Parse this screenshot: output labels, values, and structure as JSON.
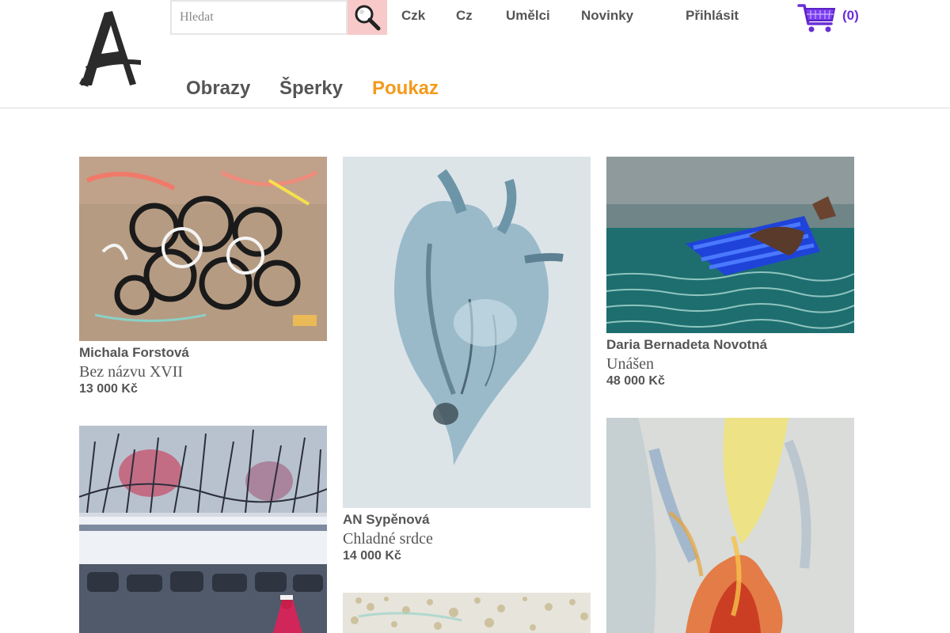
{
  "brand": {
    "logo_letter": "A"
  },
  "search": {
    "placeholder": "Hledat"
  },
  "top_nav": {
    "currency": "Czk",
    "language": "Cz",
    "artists": "Umělci",
    "news": "Novinky",
    "login": "Přihlásit"
  },
  "cart": {
    "count_label": "(0)"
  },
  "main_nav": {
    "paintings": "Obrazy",
    "jewelry": "Šperky",
    "voucher": "Poukaz"
  },
  "colors": {
    "accent": "#f39a1b",
    "cart": "#6a2fd6",
    "search_button": "#f8c9c9",
    "text": "#555555"
  },
  "products": [
    {
      "artist": "Michala Forstová",
      "title": "Bez názvu XVII",
      "price": "13 000 Kč"
    },
    {
      "artist": "AN Sypěnová",
      "title": "Chladné srdce",
      "price": "14 000 Kč"
    },
    {
      "artist": "Daria Bernadeta Novotná",
      "title": "Unášen",
      "price": "48 000 Kč"
    }
  ]
}
